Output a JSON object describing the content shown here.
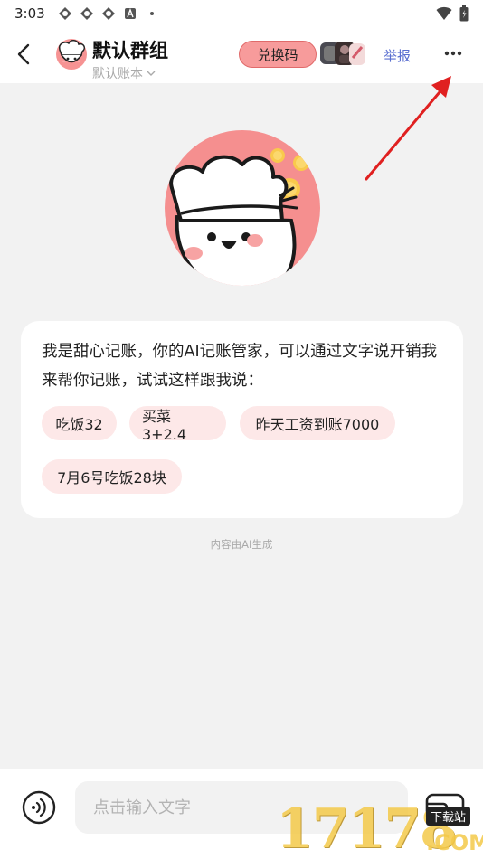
{
  "status_bar": {
    "time": "3:03"
  },
  "header": {
    "title": "默认群组",
    "subtitle": "默认账本",
    "redeem_label": "兑换码",
    "report_label": "举报"
  },
  "card": {
    "intro": "我是甜心记账，你的AI记账管家，可以通过文字说开销我来帮你记账，试试这样跟我说：",
    "suggestions": [
      "吃饭32",
      "买菜3+2.4",
      "昨天工资到账7000",
      "7月6号吃饭28块"
    ]
  },
  "ai_note": "内容由AI生成",
  "input": {
    "placeholder": "点击输入文字"
  },
  "watermark": {
    "number": "17178",
    "tag": "下载站",
    "domain": ".COM"
  },
  "colors": {
    "accent": "#f79b9b",
    "chip_bg": "#fde8e8",
    "report": "#5a6fd0",
    "arrow": "#e02020"
  }
}
